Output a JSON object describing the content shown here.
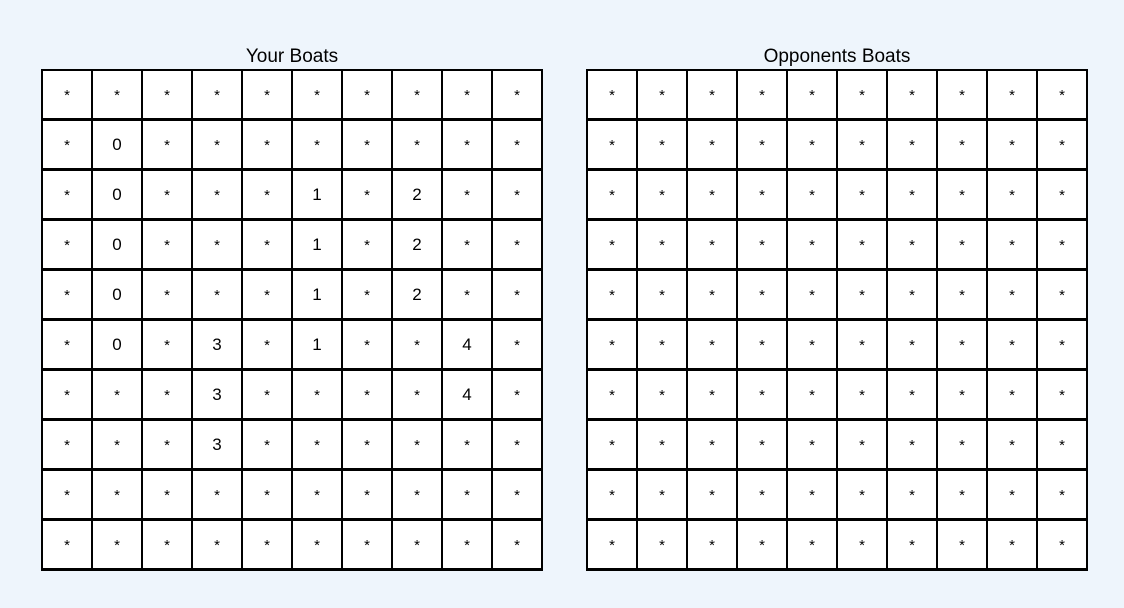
{
  "header": {
    "title": ""
  },
  "boards": {
    "your": {
      "title": "Your Boats",
      "rows": [
        [
          "*",
          "*",
          "*",
          "*",
          "*",
          "*",
          "*",
          "*",
          "*",
          "*"
        ],
        [
          "*",
          "0",
          "*",
          "*",
          "*",
          "*",
          "*",
          "*",
          "*",
          "*"
        ],
        [
          "*",
          "0",
          "*",
          "*",
          "*",
          "1",
          "*",
          "2",
          "*",
          "*"
        ],
        [
          "*",
          "0",
          "*",
          "*",
          "*",
          "1",
          "*",
          "2",
          "*",
          "*"
        ],
        [
          "*",
          "0",
          "*",
          "*",
          "*",
          "1",
          "*",
          "2",
          "*",
          "*"
        ],
        [
          "*",
          "0",
          "*",
          "3",
          "*",
          "1",
          "*",
          "*",
          "4",
          "*"
        ],
        [
          "*",
          "*",
          "*",
          "3",
          "*",
          "*",
          "*",
          "*",
          "4",
          "*"
        ],
        [
          "*",
          "*",
          "*",
          "3",
          "*",
          "*",
          "*",
          "*",
          "*",
          "*"
        ],
        [
          "*",
          "*",
          "*",
          "*",
          "*",
          "*",
          "*",
          "*",
          "*",
          "*"
        ],
        [
          "*",
          "*",
          "*",
          "*",
          "*",
          "*",
          "*",
          "*",
          "*",
          "*"
        ]
      ]
    },
    "opponent": {
      "title": "Opponents Boats",
      "rows": [
        [
          "*",
          "*",
          "*",
          "*",
          "*",
          "*",
          "*",
          "*",
          "*",
          "*"
        ],
        [
          "*",
          "*",
          "*",
          "*",
          "*",
          "*",
          "*",
          "*",
          "*",
          "*"
        ],
        [
          "*",
          "*",
          "*",
          "*",
          "*",
          "*",
          "*",
          "*",
          "*",
          "*"
        ],
        [
          "*",
          "*",
          "*",
          "*",
          "*",
          "*",
          "*",
          "*",
          "*",
          "*"
        ],
        [
          "*",
          "*",
          "*",
          "*",
          "*",
          "*",
          "*",
          "*",
          "*",
          "*"
        ],
        [
          "*",
          "*",
          "*",
          "*",
          "*",
          "*",
          "*",
          "*",
          "*",
          "*"
        ],
        [
          "*",
          "*",
          "*",
          "*",
          "*",
          "*",
          "*",
          "*",
          "*",
          "*"
        ],
        [
          "*",
          "*",
          "*",
          "*",
          "*",
          "*",
          "*",
          "*",
          "*",
          "*"
        ],
        [
          "*",
          "*",
          "*",
          "*",
          "*",
          "*",
          "*",
          "*",
          "*",
          "*"
        ],
        [
          "*",
          "*",
          "*",
          "*",
          "*",
          "*",
          "*",
          "*",
          "*",
          "*"
        ]
      ]
    }
  }
}
